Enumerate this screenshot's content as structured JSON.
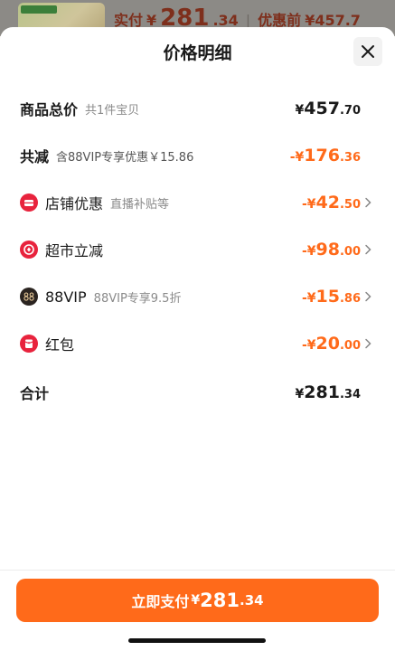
{
  "background": {
    "text": "实付",
    "currency": "¥",
    "amount_int": "281",
    "amount_dec": ".34",
    "divider": "|",
    "before_label": "优惠前",
    "before_amount": "¥457.7"
  },
  "sheet": {
    "title": "价格明细",
    "close_icon": "close-icon"
  },
  "rows": {
    "total": {
      "label": "商品总价",
      "sub": "共1件宝贝",
      "currency": "¥",
      "int": "457",
      "dec": ".70"
    },
    "reduction": {
      "label": "共减",
      "sub": "含88VIP专享优惠￥15.86",
      "currency": "-¥",
      "int": "176",
      "dec": ".36"
    },
    "store": {
      "label": "店铺优惠",
      "sub": "直播补贴等",
      "currency": "-¥",
      "int": "42",
      "dec": ".50",
      "icon": "store-coupon-icon",
      "icon_color": "#e8233d"
    },
    "market": {
      "label": "超市立减",
      "sub": "",
      "currency": "-¥",
      "int": "98",
      "dec": ".00",
      "icon": "supermarket-icon",
      "icon_color": "#e8233d"
    },
    "vip": {
      "label": "88VIP",
      "sub": "88VIP专享9.5折",
      "currency": "-¥",
      "int": "15",
      "dec": ".86",
      "icon": "vip-88-icon",
      "icon_color": "#2b2420"
    },
    "redpacket": {
      "label": "红包",
      "sub": "",
      "currency": "-¥",
      "int": "20",
      "dec": ".00",
      "icon": "red-packet-icon",
      "icon_color": "#e8233d"
    },
    "sum": {
      "label": "合计",
      "currency": "¥",
      "int": "281",
      "dec": ".34"
    }
  },
  "pay": {
    "label": "立即支付",
    "currency": "¥",
    "int": "281",
    "dec": ".34"
  },
  "colors": {
    "accent": "#ff6a1a",
    "text": "#1a1a1a",
    "muted": "#8a8a8a",
    "icon_red": "#e8233d"
  }
}
